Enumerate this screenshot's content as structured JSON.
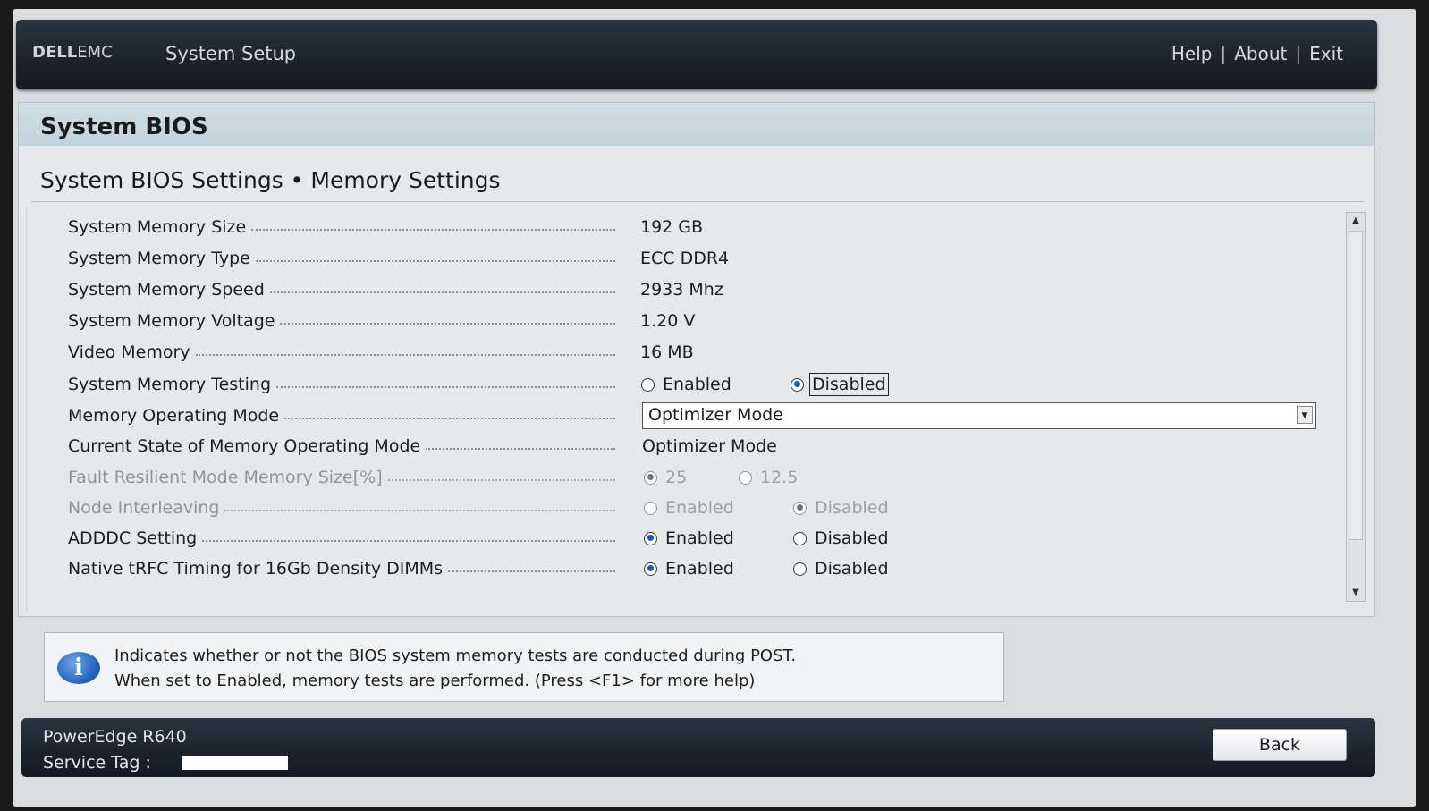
{
  "header": {
    "brand_dell": "DELL",
    "brand_emc": "EMC",
    "app_title": "System Setup",
    "links": [
      "Help",
      "About",
      "Exit"
    ],
    "separator": "|"
  },
  "panel": {
    "section_title": "System BIOS",
    "page_subtitle": "System BIOS Settings • Memory Settings"
  },
  "settings": {
    "memory_size": {
      "label": "System Memory Size",
      "value": "192 GB"
    },
    "memory_type": {
      "label": "System Memory Type",
      "value": "ECC DDR4"
    },
    "memory_speed": {
      "label": "System Memory Speed",
      "value": "2933 Mhz"
    },
    "memory_voltage": {
      "label": "System Memory Voltage",
      "value": "1.20 V"
    },
    "video_memory": {
      "label": "Video Memory",
      "value": "16 MB"
    },
    "memory_testing": {
      "label": "System Memory Testing",
      "options": [
        "Enabled",
        "Disabled"
      ],
      "selected": "Disabled"
    },
    "operating_mode": {
      "label": "Memory Operating Mode",
      "value": "Optimizer Mode"
    },
    "current_mode": {
      "label": "Current State of Memory Operating Mode",
      "value": "Optimizer Mode"
    },
    "fault_resilient": {
      "label": "Fault Resilient Mode Memory Size[%]",
      "options": [
        "25",
        "12.5"
      ],
      "selected": "25",
      "disabled": true
    },
    "node_interleaving": {
      "label": "Node Interleaving",
      "options": [
        "Enabled",
        "Disabled"
      ],
      "selected": "Disabled",
      "disabled": true
    },
    "adddc": {
      "label": "ADDDC Setting",
      "options": [
        "Enabled",
        "Disabled"
      ],
      "selected": "Enabled"
    },
    "native_trfc": {
      "label": "Native tRFC Timing for 16Gb Density DIMMs",
      "options": [
        "Enabled",
        "Disabled"
      ],
      "selected": "Enabled"
    }
  },
  "help": {
    "icon": "info-icon",
    "line1": "Indicates whether or not the BIOS system memory tests are conducted during POST.",
    "line2": "When set to Enabled, memory tests are performed. (Press <F1> for more help)"
  },
  "footer": {
    "model": "PowerEdge R640",
    "service_tag_label": "Service Tag :",
    "back_label": "Back"
  },
  "colors": {
    "accent_blue": "#1c58b9",
    "bar_dark": "#1b222c",
    "section_bar": "#c8d6dd"
  }
}
